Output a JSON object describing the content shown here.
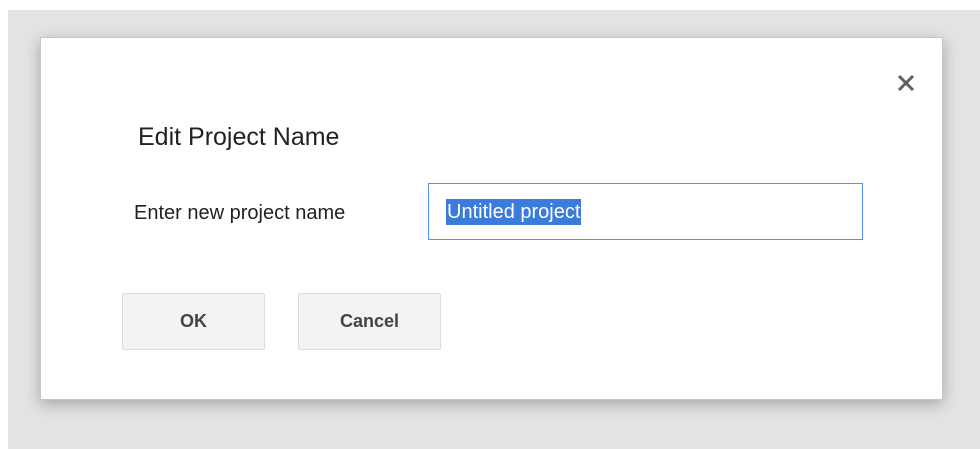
{
  "dialog": {
    "title": "Edit Project Name",
    "field_label": "Enter new project name",
    "input_value": "Untitled project",
    "ok_label": "OK",
    "cancel_label": "Cancel",
    "close_icon": "close-icon"
  },
  "colors": {
    "backdrop": "#e3e3e3",
    "focus_border": "#4d90fe",
    "selection": "#3a7bdc",
    "button_bg": "#f3f3f3"
  }
}
